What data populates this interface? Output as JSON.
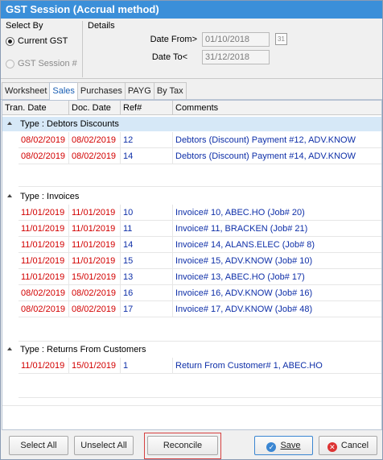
{
  "window": {
    "title": "GST Session (Accrual method)"
  },
  "select_by": {
    "title": "Select By",
    "options": [
      {
        "label": "Current GST",
        "checked": true,
        "enabled": true
      },
      {
        "label": "GST Session #",
        "checked": false,
        "enabled": false
      }
    ]
  },
  "details": {
    "title": "Details",
    "date_from_label": "Date From>",
    "date_from_value": "01/10/2018",
    "date_to_label": "Date To<",
    "date_to_value": "31/12/2018",
    "calendar_icon_text": "31"
  },
  "tabs": [
    {
      "label": "Worksheet",
      "active": false
    },
    {
      "label": "Sales",
      "active": true
    },
    {
      "label": "Purchases",
      "active": false
    },
    {
      "label": "PAYG",
      "active": false
    },
    {
      "label": "By Tax",
      "active": false
    }
  ],
  "grid": {
    "columns": [
      "Tran. Date",
      "Doc. Date",
      "Ref#",
      "Comments"
    ],
    "groups": [
      {
        "title": "Type : Debtors Discounts",
        "rows": [
          {
            "tran_date": "08/02/2019",
            "doc_date": "08/02/2019",
            "ref": "12",
            "comment": "Debtors (Discount) Payment #12, ADV.KNOW"
          },
          {
            "tran_date": "08/02/2019",
            "doc_date": "08/02/2019",
            "ref": "14",
            "comment": "Debtors (Discount) Payment #14, ADV.KNOW"
          }
        ]
      },
      {
        "title": "Type : Invoices",
        "rows": [
          {
            "tran_date": "11/01/2019",
            "doc_date": "11/01/2019",
            "ref": "10",
            "comment": "Invoice# 10, ABEC.HO (Job# 20)"
          },
          {
            "tran_date": "11/01/2019",
            "doc_date": "11/01/2019",
            "ref": "11",
            "comment": "Invoice# 11, BRACKEN (Job# 21)"
          },
          {
            "tran_date": "11/01/2019",
            "doc_date": "11/01/2019",
            "ref": "14",
            "comment": "Invoice# 14, ALANS.ELEC (Job# 8)"
          },
          {
            "tran_date": "11/01/2019",
            "doc_date": "11/01/2019",
            "ref": "15",
            "comment": "Invoice# 15, ADV.KNOW (Job# 10)"
          },
          {
            "tran_date": "11/01/2019",
            "doc_date": "15/01/2019",
            "ref": "13",
            "comment": "Invoice# 13, ABEC.HO (Job# 17)"
          },
          {
            "tran_date": "08/02/2019",
            "doc_date": "08/02/2019",
            "ref": "16",
            "comment": "Invoice# 16, ADV.KNOW (Job# 16)"
          },
          {
            "tran_date": "08/02/2019",
            "doc_date": "08/02/2019",
            "ref": "17",
            "comment": "Invoice# 17, ADV.KNOW (Job# 48)"
          }
        ]
      },
      {
        "title": "Type : Returns From Customers",
        "rows": [
          {
            "tran_date": "11/01/2019",
            "doc_date": "15/01/2019",
            "ref": "1",
            "comment": "Return From Customer# 1, ABEC.HO"
          }
        ]
      }
    ]
  },
  "buttons": {
    "select_all": "Select All",
    "unselect_all": "Unselect All",
    "reconcile": "Reconcile",
    "save": "Save",
    "cancel": "Cancel"
  },
  "colors": {
    "title_bar": "#3b8fd9",
    "date_text": "#d20000",
    "ref_text": "#0e2fa8",
    "selected_group": "#d6e8f7",
    "highlight": "#d64040"
  }
}
